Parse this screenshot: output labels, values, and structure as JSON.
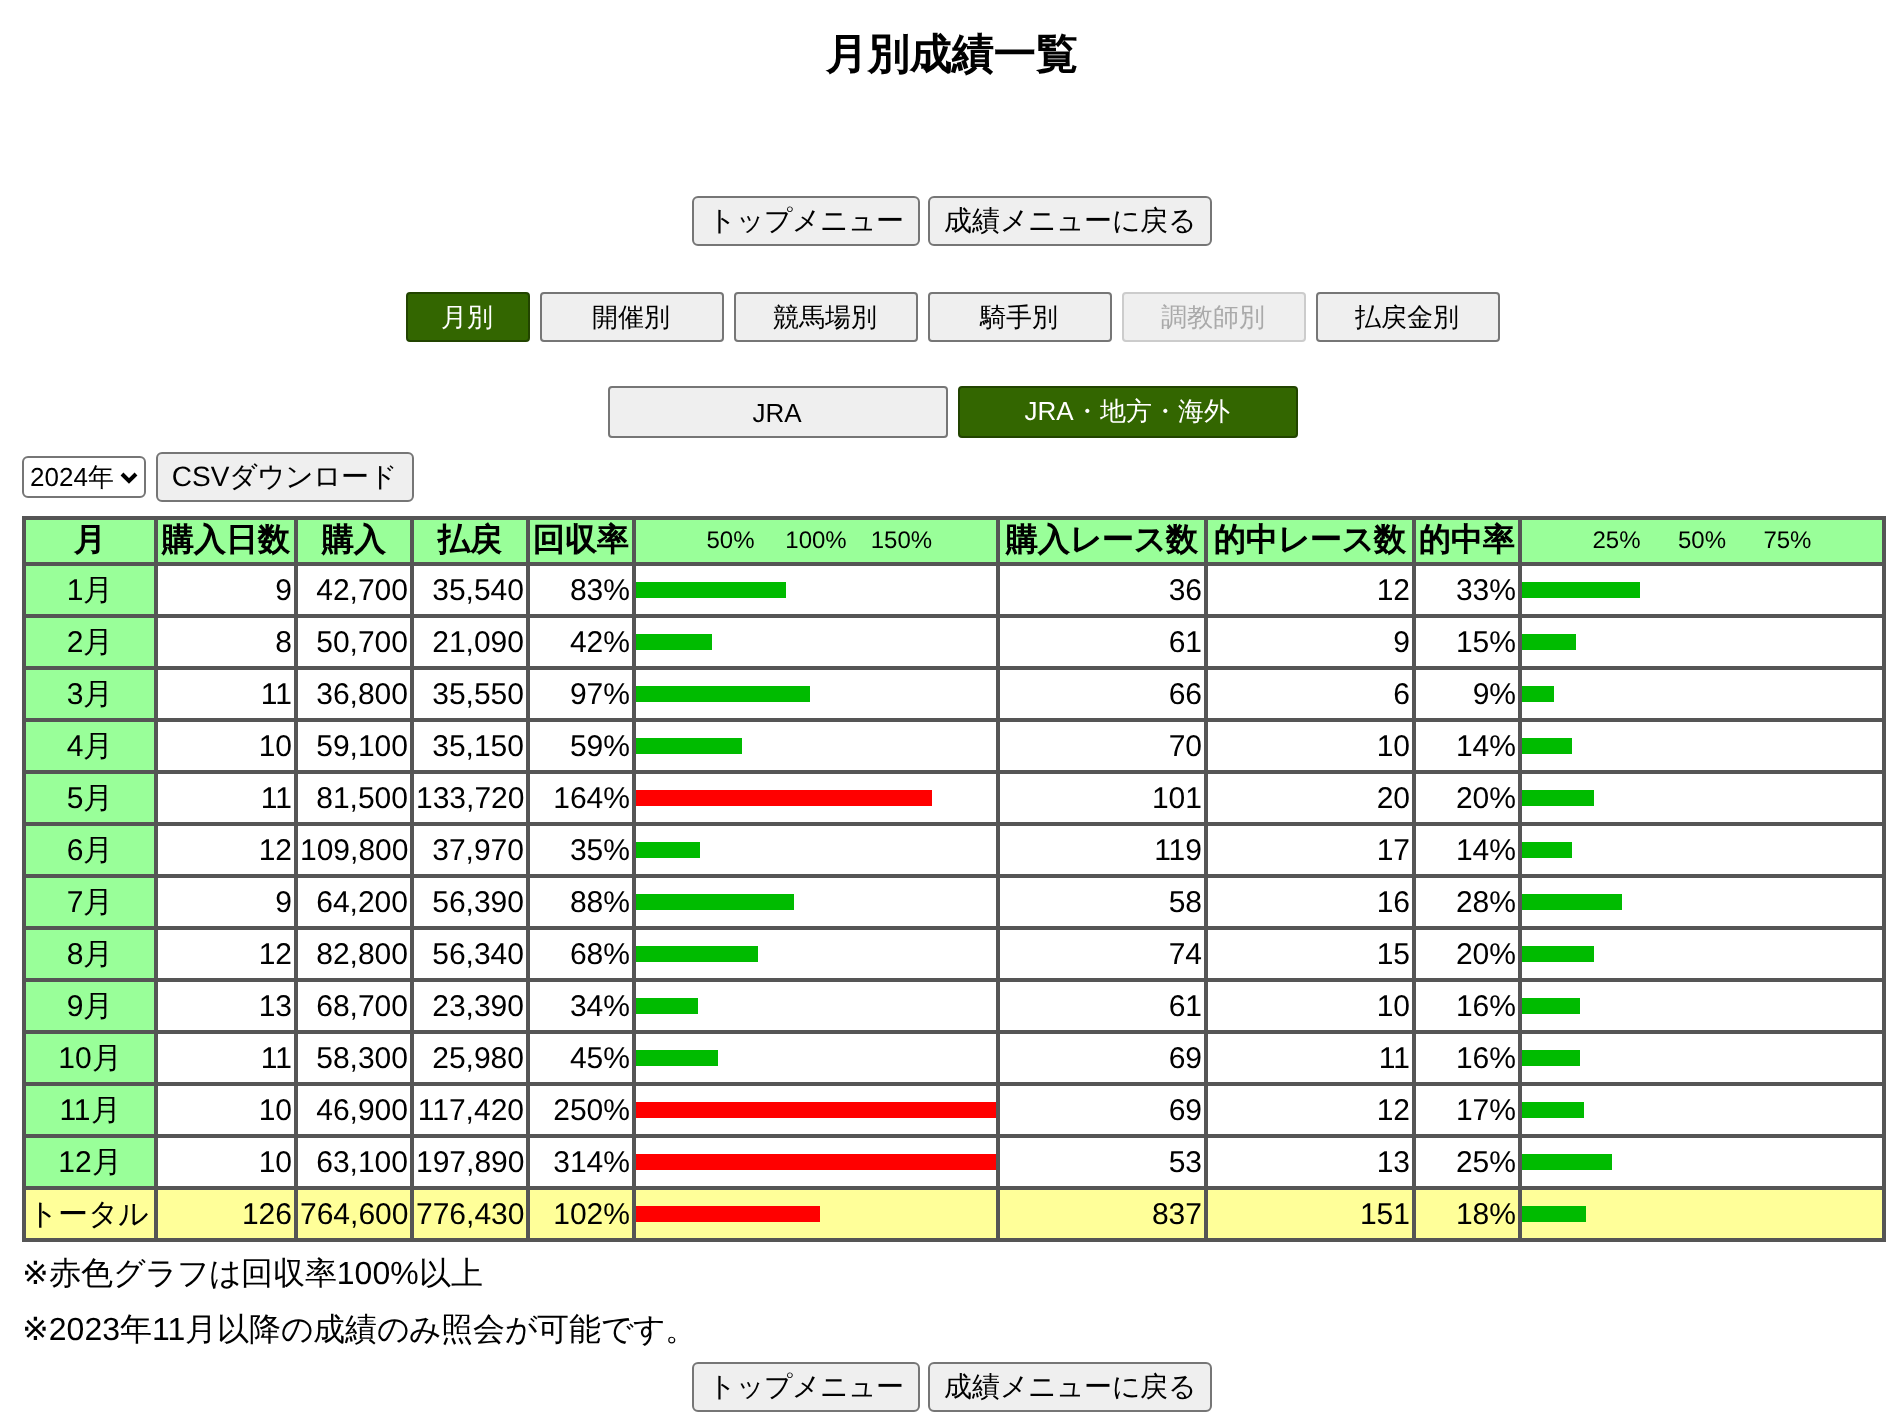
{
  "title": "月別成績一覧",
  "nav_top": [
    "トップメニュー",
    "成績メニューに戻る"
  ],
  "tabs": [
    {
      "label": "月別",
      "selected": true,
      "disabled": false
    },
    {
      "label": "開催別",
      "selected": false,
      "disabled": false
    },
    {
      "label": "競馬場別",
      "selected": false,
      "disabled": false
    },
    {
      "label": "騎手別",
      "selected": false,
      "disabled": false
    },
    {
      "label": "調教師別",
      "selected": false,
      "disabled": true
    },
    {
      "label": "払戻金別",
      "selected": false,
      "disabled": false
    }
  ],
  "scope_tabs": [
    {
      "label": "JRA",
      "selected": false
    },
    {
      "label": "JRA・地方・海外",
      "selected": true
    }
  ],
  "year_select": {
    "value": "2024年"
  },
  "csv_button": "CSVダウンロード",
  "table": {
    "columns": [
      "月",
      "購入日数",
      "購入",
      "払戻",
      "回収率",
      "購入レース数",
      "的中レース数",
      "的中率"
    ],
    "return_ticks": [
      "50%",
      "100%",
      "150%"
    ],
    "hit_ticks": [
      "25%",
      "50%",
      "75%"
    ],
    "rows": [
      {
        "month": "1月",
        "days": "9",
        "bought": "42,700",
        "payout": "35,540",
        "return": "83%",
        "return_bar": {
          "level": 0.415,
          "color": "#00bb00"
        },
        "races": "36",
        "hits": "12",
        "hit_rate": "33%",
        "hit_bar": {
          "level": 0.33
        }
      },
      {
        "month": "2月",
        "days": "8",
        "bought": "50,700",
        "payout": "21,090",
        "return": "42%",
        "return_bar": {
          "level": 0.21,
          "color": "#00bb00"
        },
        "races": "61",
        "hits": "9",
        "hit_rate": "15%",
        "hit_bar": {
          "level": 0.15
        }
      },
      {
        "month": "3月",
        "days": "11",
        "bought": "36,800",
        "payout": "35,550",
        "return": "97%",
        "return_bar": {
          "level": 0.485,
          "color": "#00bb00"
        },
        "races": "66",
        "hits": "6",
        "hit_rate": "9%",
        "hit_bar": {
          "level": 0.09
        }
      },
      {
        "month": "4月",
        "days": "10",
        "bought": "59,100",
        "payout": "35,150",
        "return": "59%",
        "return_bar": {
          "level": 0.295,
          "color": "#00bb00"
        },
        "races": "70",
        "hits": "10",
        "hit_rate": "14%",
        "hit_bar": {
          "level": 0.14
        }
      },
      {
        "month": "5月",
        "days": "11",
        "bought": "81,500",
        "payout": "133,720",
        "return": "164%",
        "return_bar": {
          "level": 0.82,
          "color": "#ff0000"
        },
        "races": "101",
        "hits": "20",
        "hit_rate": "20%",
        "hit_bar": {
          "level": 0.2
        }
      },
      {
        "month": "6月",
        "days": "12",
        "bought": "109,800",
        "payout": "37,970",
        "return": "35%",
        "return_bar": {
          "level": 0.175,
          "color": "#00bb00"
        },
        "races": "119",
        "hits": "17",
        "hit_rate": "14%",
        "hit_bar": {
          "level": 0.14
        }
      },
      {
        "month": "7月",
        "days": "9",
        "bought": "64,200",
        "payout": "56,390",
        "return": "88%",
        "return_bar": {
          "level": 0.44,
          "color": "#00bb00"
        },
        "races": "58",
        "hits": "16",
        "hit_rate": "28%",
        "hit_bar": {
          "level": 0.28
        }
      },
      {
        "month": "8月",
        "days": "12",
        "bought": "82,800",
        "payout": "56,340",
        "return": "68%",
        "return_bar": {
          "level": 0.34,
          "color": "#00bb00"
        },
        "races": "74",
        "hits": "15",
        "hit_rate": "20%",
        "hit_bar": {
          "level": 0.2
        }
      },
      {
        "month": "9月",
        "days": "13",
        "bought": "68,700",
        "payout": "23,390",
        "return": "34%",
        "return_bar": {
          "level": 0.17,
          "color": "#00bb00"
        },
        "races": "61",
        "hits": "10",
        "hit_rate": "16%",
        "hit_bar": {
          "level": 0.16
        }
      },
      {
        "month": "10月",
        "days": "11",
        "bought": "58,300",
        "payout": "25,980",
        "return": "45%",
        "return_bar": {
          "level": 0.225,
          "color": "#00bb00"
        },
        "races": "69",
        "hits": "11",
        "hit_rate": "16%",
        "hit_bar": {
          "level": 0.16
        }
      },
      {
        "month": "11月",
        "days": "10",
        "bought": "46,900",
        "payout": "117,420",
        "return": "250%",
        "return_bar": {
          "level": 1,
          "color": "#ff0000"
        },
        "races": "69",
        "hits": "12",
        "hit_rate": "17%",
        "hit_bar": {
          "level": 0.17
        }
      },
      {
        "month": "12月",
        "days": "10",
        "bought": "63,100",
        "payout": "197,890",
        "return": "314%",
        "return_bar": {
          "level": 1,
          "color": "#ff0000"
        },
        "races": "53",
        "hits": "13",
        "hit_rate": "25%",
        "hit_bar": {
          "level": 0.25
        }
      }
    ],
    "total": {
      "month": "トータル",
      "days": "126",
      "bought": "764,600",
      "payout": "776,430",
      "return": "102%",
      "return_bar": {
        "level": 0.51,
        "color": "#ff0000"
      },
      "races": "837",
      "hits": "151",
      "hit_rate": "18%",
      "hit_bar": {
        "level": 0.18
      }
    }
  },
  "notes": [
    "※赤色グラフは回収率100%以上",
    "※2023年11月以降の成績のみ照会が可能です。"
  ],
  "nav_bottom": [
    "トップメニュー",
    "成績メニューに戻る"
  ]
}
